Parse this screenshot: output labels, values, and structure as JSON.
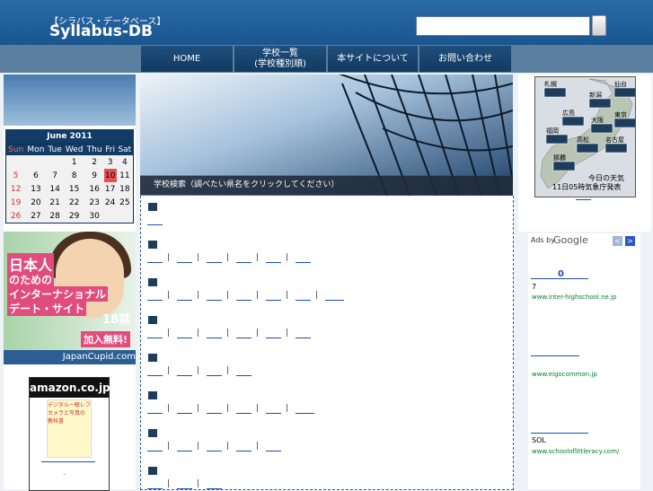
{
  "header": {
    "kana": "【シラバス・データベース】",
    "title": "Syllabus-DB",
    "search_placeholder": ""
  },
  "nav": [
    {
      "label": "HOME"
    },
    {
      "label": "学校一覧\n(学校種別順)"
    },
    {
      "label": "本サイトについて"
    },
    {
      "label": "お問い合わせ"
    }
  ],
  "calendar": {
    "caption": "June 2011",
    "weekdays": [
      "Sun",
      "Mon",
      "Tue",
      "Wed",
      "Thu",
      "Fri",
      "Sat"
    ],
    "weeks": [
      [
        "",
        "",
        "",
        "1",
        "2",
        "3",
        "4"
      ],
      [
        "5",
        "6",
        "7",
        "8",
        "9",
        "10",
        "11"
      ],
      [
        "12",
        "13",
        "14",
        "15",
        "16",
        "17",
        "18"
      ],
      [
        "19",
        "20",
        "21",
        "22",
        "23",
        "24",
        "25"
      ],
      [
        "26",
        "27",
        "28",
        "29",
        "30",
        "",
        ""
      ]
    ],
    "today": "10"
  },
  "ad_left": {
    "line1": "日本人",
    "line2": "のための",
    "line3": "インターナショナル",
    "line4": "デート・サイト",
    "age": "18禁",
    "free": "加入無料!",
    "brand": "JapanCupid.com"
  },
  "amazon": {
    "logo": "amazon.co.jp",
    "book_text": "デジタル一眼レフ カメラと写真の 教科書",
    "dot": "."
  },
  "hero": {
    "caption": "学校検索（調べたい県名をクリックしてください）"
  },
  "weather": {
    "cities": [
      "札幌",
      "新潟",
      "仙台",
      "広島",
      "大阪",
      "東京",
      "福岡",
      "高松",
      "名古屋",
      "那覇"
    ],
    "label1": "今日の天気",
    "label2": "11日05時気象庁発表",
    "link_text": "- . -"
  },
  "ads_right": {
    "ads_by": "Ads by",
    "google": "Google",
    "prev": "<",
    "next": ">",
    "num": "0",
    "items": [
      {
        "text": "7",
        "url": "www.inter-highschool.ne.jp"
      },
      {
        "text": "",
        "url": "www.eigocommon.jp"
      },
      {
        "text": "SOL",
        "url": "www.schooloflittleracy.com/"
      }
    ]
  }
}
